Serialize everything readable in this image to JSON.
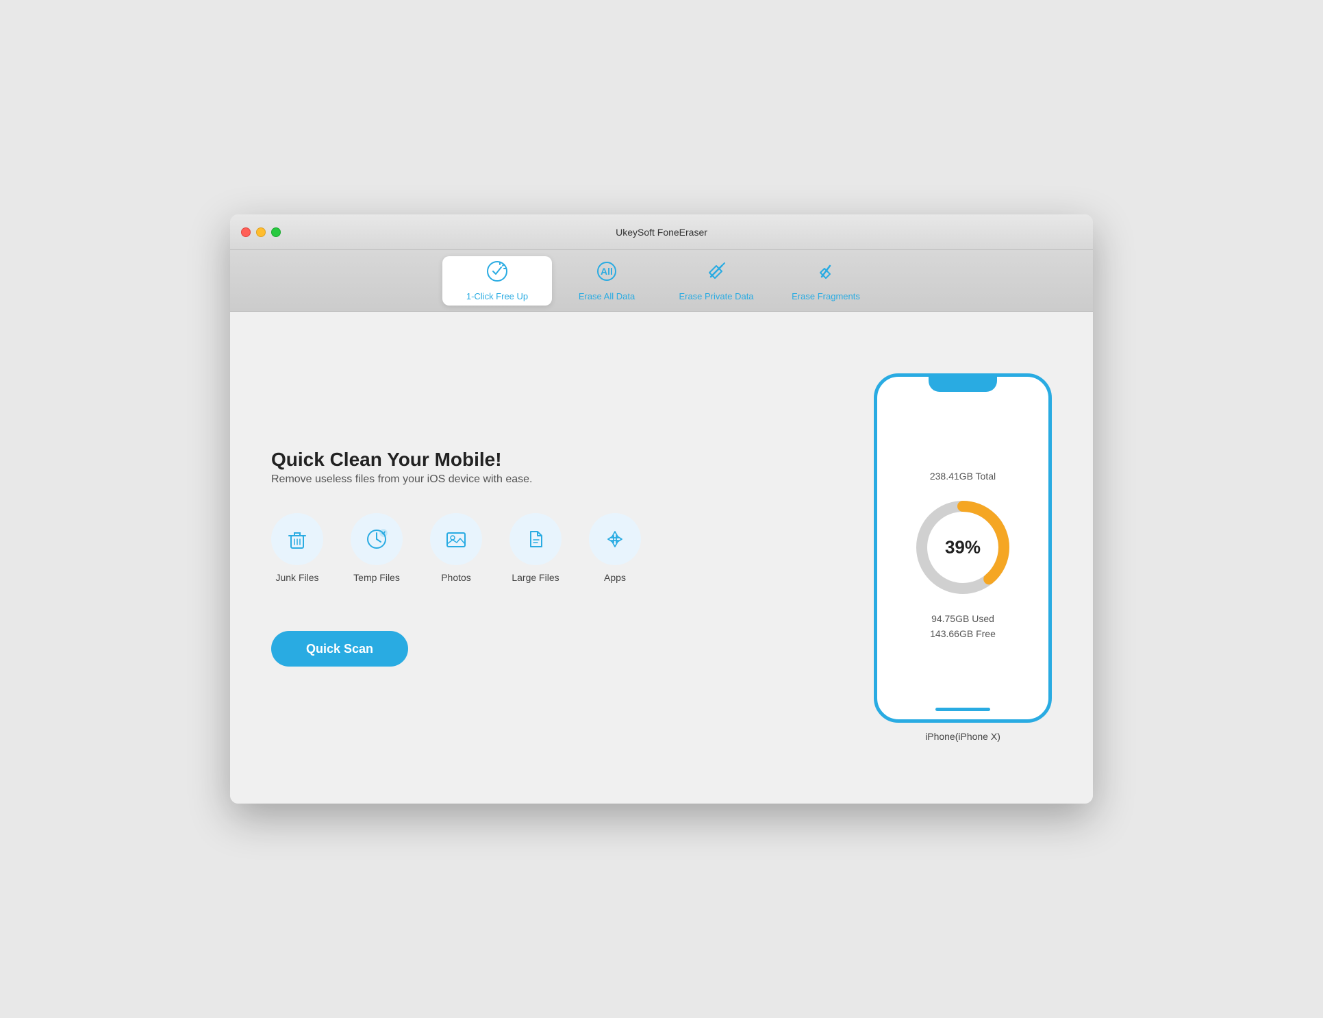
{
  "window": {
    "title": "UkeySoft FoneEraser"
  },
  "titlebar": {
    "title": "UkeySoft FoneEraser"
  },
  "tabs": [
    {
      "id": "one-click",
      "label": "1-Click Free Up",
      "active": true
    },
    {
      "id": "erase-all",
      "label": "Erase All Data",
      "active": false
    },
    {
      "id": "erase-private",
      "label": "Erase Private Data",
      "active": false
    },
    {
      "id": "erase-fragments",
      "label": "Erase Fragments",
      "active": false
    }
  ],
  "main": {
    "title": "Quick Clean Your Mobile!",
    "subtitle": "Remove useless files from your iOS device with ease."
  },
  "features": [
    {
      "id": "junk-files",
      "label": "Junk Files"
    },
    {
      "id": "temp-files",
      "label": "Temp Files"
    },
    {
      "id": "photos",
      "label": "Photos"
    },
    {
      "id": "large-files",
      "label": "Large Files"
    },
    {
      "id": "apps",
      "label": "Apps"
    }
  ],
  "quickscan": {
    "label": "Quick Scan"
  },
  "device": {
    "total": "238.41GB Total",
    "percent": "39%",
    "used": "94.75GB Used",
    "free": "143.66GB Free",
    "name": "iPhone(iPhone X)"
  },
  "colors": {
    "blue": "#29abe2",
    "orange": "#f5a623",
    "gray_ring": "#d0d0d0"
  }
}
